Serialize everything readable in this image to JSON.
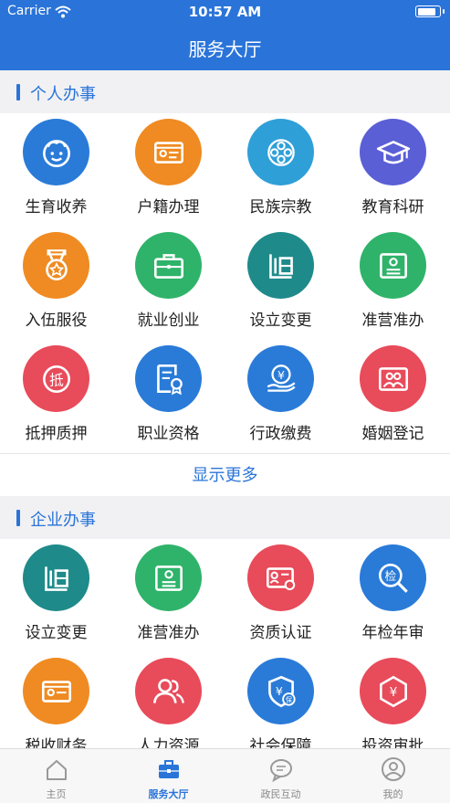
{
  "status_bar": {
    "carrier": "Carrier",
    "time": "10:57 AM",
    "battery_level": 0.85
  },
  "nav": {
    "title": "服务大厅"
  },
  "personal": {
    "title": "个人办事",
    "items": [
      {
        "label": "生育收养",
        "icon": "baby-face-icon",
        "color": "#2a7bd8"
      },
      {
        "label": "户籍办理",
        "icon": "id-card-icon",
        "color": "#ef8b22"
      },
      {
        "label": "民族宗教",
        "icon": "knot-icon",
        "color": "#2f9fd8"
      },
      {
        "label": "教育科研",
        "icon": "graduation-cap-icon",
        "color": "#5a5fd6"
      },
      {
        "label": "入伍服役",
        "icon": "medal-icon",
        "color": "#ef8b22"
      },
      {
        "label": "就业创业",
        "icon": "briefcase-icon",
        "color": "#2fb36a"
      },
      {
        "label": "设立变更",
        "icon": "setup-document-icon",
        "color": "#1f8a8a"
      },
      {
        "label": "准营准办",
        "icon": "license-card-icon",
        "color": "#2fb36a"
      },
      {
        "label": "抵押质押",
        "icon": "mortgage-stamp-icon",
        "color": "#e84b5a"
      },
      {
        "label": "职业资格",
        "icon": "certificate-icon",
        "color": "#2a7bd8"
      },
      {
        "label": "行政缴费",
        "icon": "yuan-hand-icon",
        "color": "#2a7bd8"
      },
      {
        "label": "婚姻登记",
        "icon": "couple-photo-icon",
        "color": "#e84b5a"
      }
    ],
    "more_label": "显示更多"
  },
  "enterprise": {
    "title": "企业办事",
    "items": [
      {
        "label": "设立变更",
        "icon": "setup-document-icon",
        "color": "#1f8a8a"
      },
      {
        "label": "准营准办",
        "icon": "license-card-icon",
        "color": "#2fb36a"
      },
      {
        "label": "资质认证",
        "icon": "qualification-card-icon",
        "color": "#e84b5a"
      },
      {
        "label": "年检年审",
        "icon": "inspection-search-icon",
        "color": "#2a7bd8"
      },
      {
        "label": "税收财务",
        "icon": "tax-card-icon",
        "color": "#ef8b22"
      },
      {
        "label": "人力资源",
        "icon": "people-icon",
        "color": "#e84b5a"
      },
      {
        "label": "社会保障",
        "icon": "social-security-shield-icon",
        "color": "#2a7bd8"
      },
      {
        "label": "投资审批",
        "icon": "yuan-hexagon-icon",
        "color": "#e84b5a"
      }
    ]
  },
  "tabbar": {
    "tabs": [
      {
        "label": "主页",
        "icon": "home-icon",
        "active": false
      },
      {
        "label": "服务大厅",
        "icon": "service-briefcase-icon",
        "active": true
      },
      {
        "label": "政民互动",
        "icon": "chat-bubble-icon",
        "active": false
      },
      {
        "label": "我的",
        "icon": "user-icon",
        "active": false
      }
    ]
  }
}
